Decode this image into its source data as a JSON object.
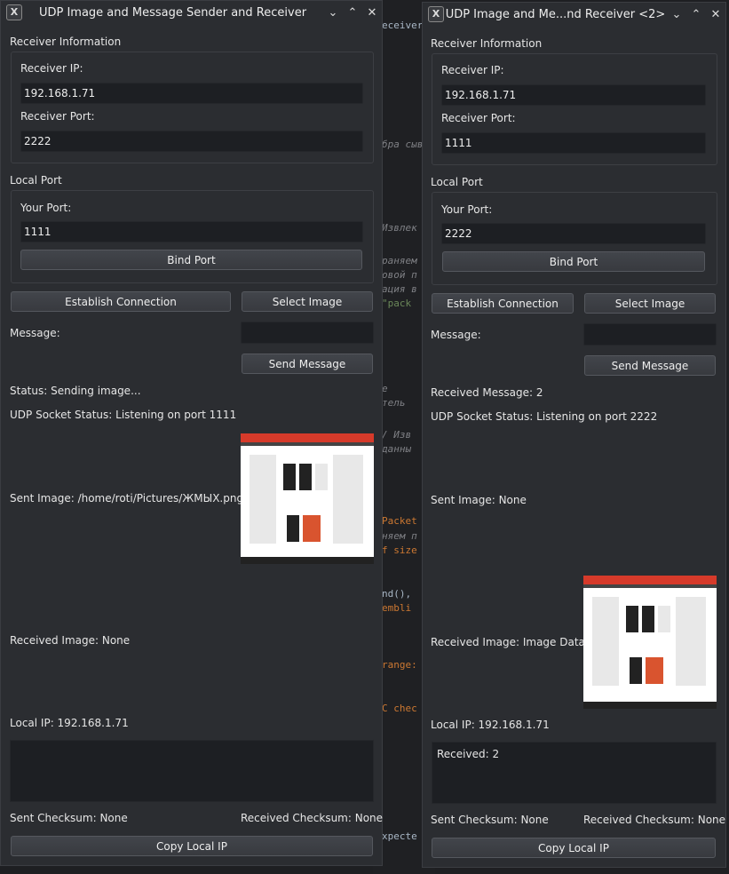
{
  "editor_fragments": [
    "eceiver(i",
    "бра сыв",
    "Извлек",
    "раняем",
    "овой п",
    "ация в",
    "\"pack",
    "е",
    "тель",
    "/ Изв",
    "данны",
    "Packet",
    "няем п",
    "f size",
    "nd(),",
    "embli",
    "range:",
    "C chec",
    "xpecte"
  ],
  "window1": {
    "title": "UDP Image and Message Sender and Receiver",
    "titlebar_buttons": [
      "⌄",
      "⌃",
      "✕"
    ],
    "receiver_section": "Receiver Information",
    "receiver_ip_label": "Receiver IP:",
    "receiver_ip_value": "192.168.1.71",
    "receiver_port_label": "Receiver Port:",
    "receiver_port_value": "2222",
    "local_section": "Local Port",
    "your_port_label": "Your Port:",
    "your_port_value": "1111",
    "bind_button": "Bind Port",
    "establish_button": "Establish Connection",
    "select_image_button": "Select Image",
    "message_label": "Message:",
    "message_value": "",
    "send_message_button": "Send Message",
    "status": "Status: Sending image...",
    "socket_status": "UDP Socket Status: Listening on port 1111",
    "sent_image": "Sent Image: /home/roti/Pictures/ЖМЫХ.png",
    "received_image": "Received Image: None",
    "local_ip": "Local IP: 192.168.1.71",
    "log_text": "",
    "sent_checksum": "Sent Checksum: None",
    "received_checksum": "Received Checksum: None",
    "copy_button": "Copy Local IP"
  },
  "window2": {
    "title": "UDP Image and Me...nd Receiver <2>",
    "titlebar_buttons": [
      "⌄",
      "⌃",
      "✕"
    ],
    "receiver_section": "Receiver Information",
    "receiver_ip_label": "Receiver IP:",
    "receiver_ip_value": "192.168.1.71",
    "receiver_port_label": "Receiver Port:",
    "receiver_port_value": "1111",
    "local_section": "Local Port",
    "your_port_label": "Your Port:",
    "your_port_value": "2222",
    "bind_button": "Bind Port",
    "establish_button": "Establish Connection",
    "select_image_button": "Select Image",
    "message_label": "Message:",
    "message_value": "",
    "send_message_button": "Send Message",
    "status": "Received Message: 2",
    "socket_status": "UDP Socket Status: Listening on port 2222",
    "sent_image": "Sent Image: None",
    "received_image": "Received Image: Image Data",
    "local_ip": "Local IP: 192.168.1.71",
    "log_text": "Received: 2",
    "sent_checksum": "Sent Checksum: None",
    "received_checksum": "Received Checksum: None",
    "copy_button": "Copy Local IP"
  },
  "colors": {
    "window_bg": "#2b2d31",
    "field_bg": "#1d1f23",
    "accent_red": "#d63a2a"
  },
  "icons": [
    "x-app-icon",
    "minimize-icon",
    "maximize-icon",
    "close-icon"
  ]
}
